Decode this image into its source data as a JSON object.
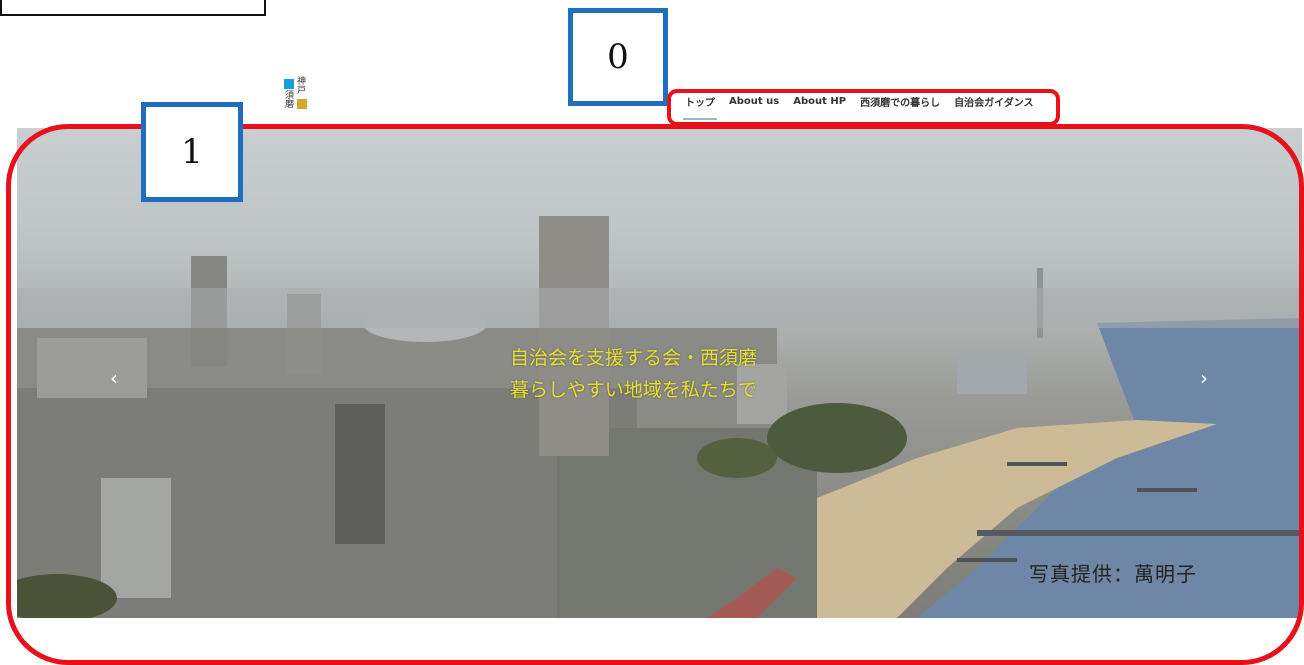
{
  "logo": {
    "chars": [
      "神",
      "戸",
      "須",
      "磨"
    ]
  },
  "nav": {
    "items": [
      {
        "label": "トップ",
        "active": true
      },
      {
        "label": "About us",
        "active": false
      },
      {
        "label": "About HP",
        "active": false
      },
      {
        "label": "西須磨での暮らし",
        "active": false
      },
      {
        "label": "自治会ガイダンス",
        "active": false
      }
    ]
  },
  "annotations": {
    "label_0": "0",
    "label_1": "1"
  },
  "hero": {
    "title_line1": "自治会を支援する会・西須磨",
    "title_line2": "暮らしやすい地域を私たちで",
    "credit": "写真提供：萬明子",
    "prev_icon": "chevron-left",
    "next_icon": "chevron-right"
  },
  "colors": {
    "highlight_red": "#e8101a",
    "label_blue": "#1f6fbd",
    "title_yellow": "#e8e030",
    "logo_blue": "#1aa0d8",
    "logo_gold": "#d4a82a"
  }
}
